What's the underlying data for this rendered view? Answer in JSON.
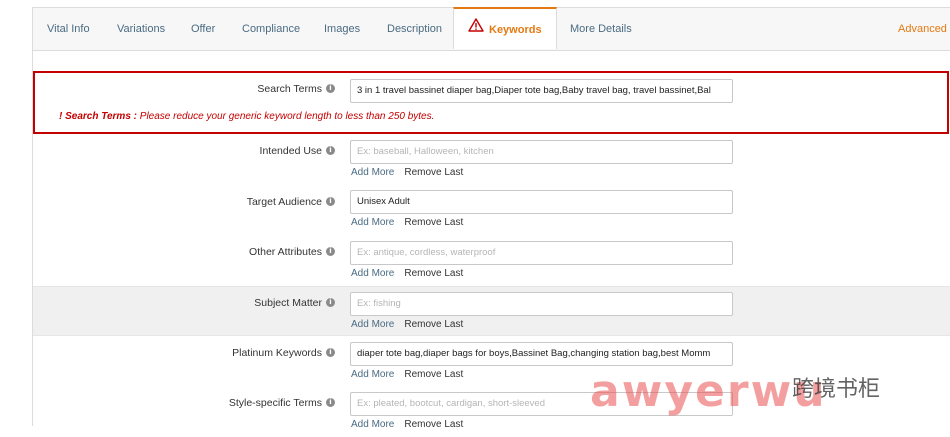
{
  "tabs": [
    {
      "label": "Vital Info"
    },
    {
      "label": "Variations"
    },
    {
      "label": "Offer"
    },
    {
      "label": "Compliance"
    },
    {
      "label": "Images"
    },
    {
      "label": "Description"
    },
    {
      "label": "Keywords",
      "active": true
    },
    {
      "label": "More Details"
    },
    {
      "label": "Advanced V"
    }
  ],
  "colors": {
    "accent": "#e47911",
    "error": "#c40000",
    "link": "#4a6b82"
  },
  "fields": {
    "search_terms": {
      "label": "Search Terms",
      "value": "3 in 1 travel bassinet diaper bag,Diaper tote bag,Baby travel bag, travel bassinet,Bal"
    },
    "error": {
      "title": "! Search Terms :",
      "message": "Please reduce your generic keyword length to less than 250 bytes."
    },
    "intended_use": {
      "label": "Intended Use",
      "placeholder": "Ex: baseball, Halloween, kitchen"
    },
    "target_audience": {
      "label": "Target Audience",
      "value": "Unisex Adult"
    },
    "other_attributes": {
      "label": "Other Attributes",
      "placeholder": "Ex: antique, cordless, waterproof"
    },
    "subject_matter": {
      "label": "Subject Matter",
      "placeholder": "Ex: fishing"
    },
    "platinum_keywords": {
      "label": "Platinum Keywords",
      "value": "diaper tote bag,diaper bags for boys,Bassinet Bag,changing station bag,best Momm"
    },
    "style_specific_terms": {
      "label": "Style-specific Terms",
      "placeholder": "Ex: pleated, bootcut, cardigan, short-sleeved"
    }
  },
  "links": {
    "add_more": "Add More",
    "remove_last": "Remove Last"
  },
  "watermark": {
    "text": "awyerwu",
    "cn": "跨境书柜"
  }
}
